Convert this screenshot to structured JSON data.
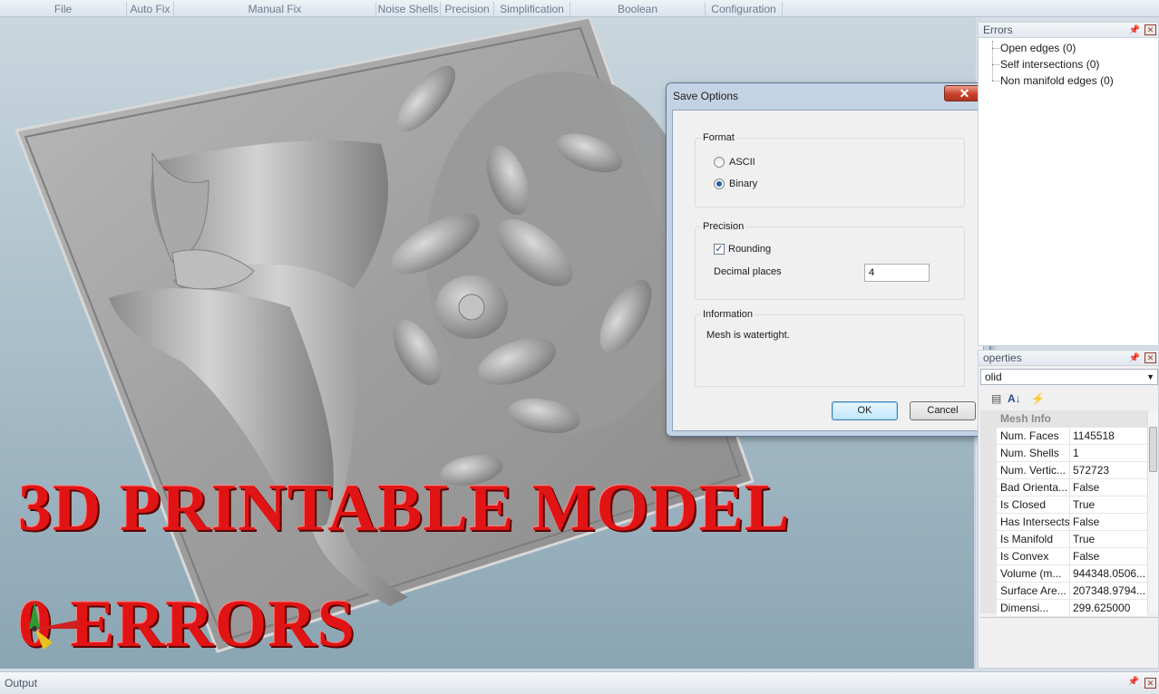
{
  "ribbon": {
    "groups": [
      "File",
      "Auto Fix",
      "Manual Fix",
      "Noise Shells",
      "Precision",
      "Simplification",
      "Boolean",
      "Configuration"
    ]
  },
  "viewport": {
    "overlay_line1": "3D PRINTABLE MODEL",
    "overlay_line2": "0 ERRORS"
  },
  "dialog": {
    "title": "Save Options",
    "close_label": "✕",
    "format": {
      "legend": "Format",
      "options": [
        "ASCII",
        "Binary"
      ],
      "selected": "Binary"
    },
    "precision": {
      "legend": "Precision",
      "rounding_label": "Rounding",
      "rounding_checked": true,
      "decimal_label": "Decimal places",
      "decimal_value": "4"
    },
    "information": {
      "legend": "Information",
      "text": "Mesh is watertight."
    },
    "ok_label": "OK",
    "cancel_label": "Cancel"
  },
  "errors_panel": {
    "title": "Errors",
    "items": [
      "Open edges (0)",
      "Self intersections (0)",
      "Non manifold edges (0)"
    ]
  },
  "properties_panel": {
    "title": "operties",
    "selected_object": "olid",
    "section": "Mesh Info",
    "rows": [
      {
        "key": "Num. Faces",
        "value": "1145518"
      },
      {
        "key": "Num. Shells",
        "value": "1"
      },
      {
        "key": "Num. Vertic...",
        "value": "572723"
      },
      {
        "key": "Bad Orienta...",
        "value": "False"
      },
      {
        "key": "Is Closed",
        "value": "True"
      },
      {
        "key": "Has Intersects",
        "value": "False"
      },
      {
        "key": "Is Manifold",
        "value": "True"
      },
      {
        "key": "Is Convex",
        "value": "False"
      },
      {
        "key": "Volume (m...",
        "value": "944348.0506..."
      },
      {
        "key": "Surface Are...",
        "value": "207348.9794..."
      },
      {
        "key": "Dimensi...",
        "value": "299.625000"
      }
    ]
  },
  "output_panel": {
    "title": "Output"
  },
  "colors": {
    "overlay_text": "#e01414",
    "viewport_bg": "#a9bec9",
    "dialog_frame": "#c4d3e4"
  }
}
